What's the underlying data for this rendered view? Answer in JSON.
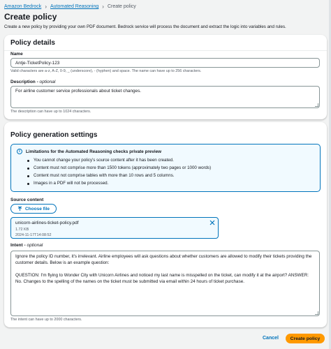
{
  "breadcrumbs": [
    "Amazon Bedrock",
    "Automated Reasoning",
    "Create policy"
  ],
  "page": {
    "title": "Create policy",
    "description": "Create a new policy by providing your own PDF document. Bedrock service will process the document and extract the logic into variables and rules."
  },
  "details": {
    "title": "Policy details",
    "name_label": "Name",
    "name_value": "Antje-TicketPolicy-123",
    "name_hint": "Valid characters are a-z, A-Z, 0-9, _ (underscore), - (hyphen) and space. The name can have up to 256 characters.",
    "desc_label": "Description",
    "optional": "optional",
    "desc_value": "For airline customer service professionals about ticket changes.",
    "desc_hint": "The description can have up to 1024 characters."
  },
  "generation": {
    "title": "Policy generation settings",
    "info_title": "Limitations for the Automated Reasoning checks private preview",
    "info_items": [
      "You cannot change your policy's source content after it has been created.",
      "Content must not comprise more than 1500 tokens (approximately two pages or 1000 words)",
      "Content must not comprise tables with more than 10 rows and 5 columns.",
      "Images in a PDF will not be processed."
    ],
    "source_label": "Source content",
    "choose_label": "Choose file",
    "file": {
      "name": "unicorn-airlines-ticket-policy.pdf",
      "size": "1.72 KB",
      "date": "2024-11-17T14:08:52"
    },
    "intent_label": "Intent",
    "optional": "optional",
    "intent_paragraphs": [
      "Ignore the policy ID number, it's irrelevant. Airline employees will ask questions about whether customers are allowed to modify their tickets providing the customer details. Below is an example question:",
      "QUESTION: I'm flying to Wonder City with Unicorn Airlines and noticed my last name is misspelled on the ticket, can modify it at the airport? ANSWER: No. Changes to the spelling of the names on the ticket must be submitted via email within 24 hours of ticket purchase."
    ],
    "intent_hint": "The intent can have up to 2000 characters."
  },
  "footer": {
    "cancel_label": "Cancel",
    "create_label": "Create policy"
  },
  "colors": {
    "link": "#0073bb",
    "primary": "#ff9900",
    "info_bg": "#f1faff"
  },
  "icons": {
    "info": "info-circle-icon",
    "upload": "upload-icon",
    "remove": "close-icon",
    "crumb_sep": "chevron-right-icon"
  }
}
